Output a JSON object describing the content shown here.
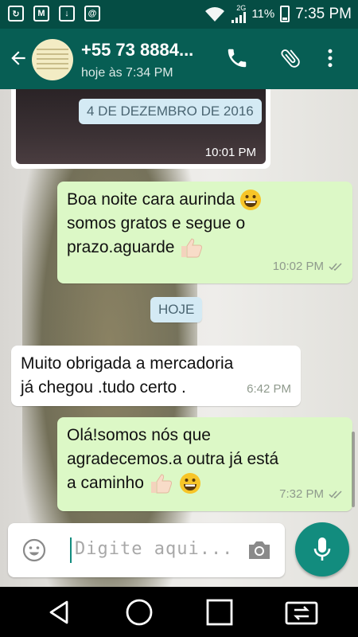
{
  "status_bar": {
    "network_type": "2G",
    "battery_percent": "11%",
    "time": "7:35 PM",
    "icons": [
      "sync-icon",
      "gmail-icon",
      "download-icon",
      "at-sign-icon",
      "wifi-icon",
      "signal-icon",
      "battery-charging-icon"
    ]
  },
  "header": {
    "contact_name": "+55 73 8884...",
    "last_seen": "hoje às 7:34 PM",
    "icons": [
      "back-arrow-icon",
      "phone-icon",
      "paperclip-icon",
      "more-vert-icon"
    ]
  },
  "chat": {
    "media_time": "10:01 PM",
    "date_chip_1": "4 DE DEZEMBRO DE 2016",
    "messages": [
      {
        "direction": "outgoing",
        "lines": [
          "Boa noite cara aurinda",
          "somos gratos e segue o",
          "prazo.aguarde"
        ],
        "time": "10:02 PM",
        "status": "read"
      },
      {
        "direction": "incoming",
        "lines": [
          "Muito obrigada a mercadoria",
          "já chegou .tudo certo ."
        ],
        "time": "6:42 PM"
      },
      {
        "direction": "outgoing",
        "lines": [
          "Olá!somos nós que",
          "agradecemos.a outra já está",
          "a caminho"
        ],
        "time": "7:32 PM",
        "status": "read"
      }
    ],
    "date_chip_2": "HOJE"
  },
  "composer": {
    "placeholder": "Digite aqui...",
    "icons": [
      "emoji-icon",
      "camera-icon",
      "mic-icon"
    ]
  },
  "colors": {
    "status_bar": "#054d44",
    "app_bar": "#075e54",
    "outgoing_bubble": "#dcf8c6",
    "incoming_bubble": "#ffffff",
    "accent": "#128c7e",
    "date_chip": "#d4eaf4"
  }
}
